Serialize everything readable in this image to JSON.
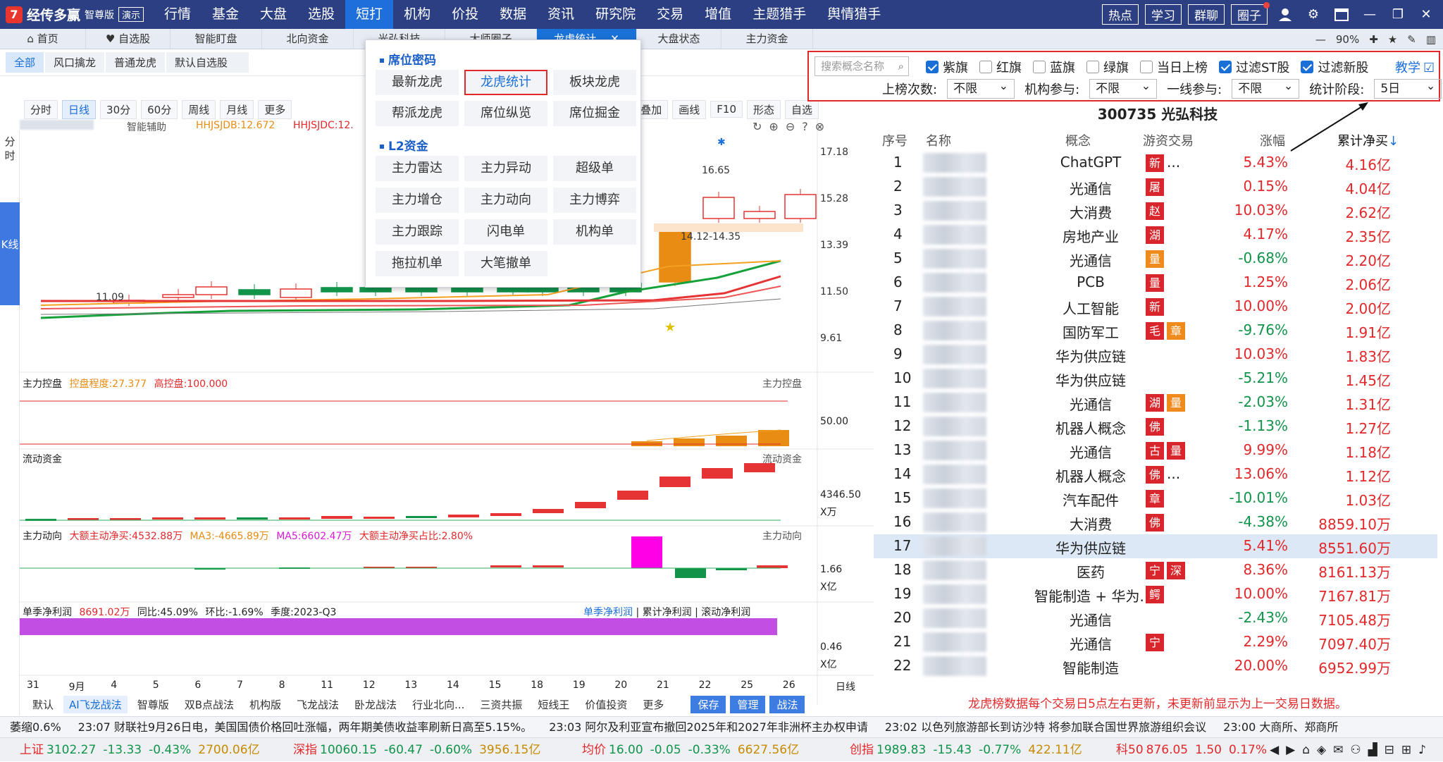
{
  "app": {
    "logo_mark": "7",
    "name": "经传多赢",
    "edition": "智尊版",
    "demo": "演示"
  },
  "main_menu": [
    "行情",
    "基金",
    "大盘",
    "选股",
    "短打",
    "机构",
    "价投",
    "数据",
    "资讯",
    "研究院",
    "交易",
    "增值",
    "主题猎手",
    "舆情猎手"
  ],
  "main_menu_active": 4,
  "top_right_buttons": [
    "热点",
    "学习",
    "群聊",
    "圈子"
  ],
  "tabs": [
    {
      "label": "首页",
      "icon": "home-icon"
    },
    {
      "label": "自选股",
      "icon": "heart-icon"
    },
    {
      "label": "智能盯盘"
    },
    {
      "label": "北向资金"
    },
    {
      "label": "光弘科技"
    },
    {
      "label": "大师圈子"
    },
    {
      "label": "龙虎统计",
      "active": true
    },
    {
      "label": "大盘状态"
    },
    {
      "label": "主力资金"
    }
  ],
  "zoom": "90%",
  "sub_tabs": [
    "全部",
    "风口擒龙",
    "普通龙虎",
    "默认自选股"
  ],
  "chart_toolbar": [
    "分时",
    "日线",
    "30分",
    "60分",
    "周线",
    "月线",
    "更多"
  ],
  "chart_toolbar_right": [
    "叠加",
    "画线",
    "F10",
    "形态",
    "自选"
  ],
  "left_strip": [
    "分时",
    "K线"
  ],
  "main_panel": {
    "assist_label": "智能辅助",
    "hhjsjdb": "HHJSJDB:12.672",
    "hhjsjdc": "HHJSJDC:12.",
    "price_labels": [
      "17.18",
      "15.28",
      "13.39",
      "11.50",
      "9.61"
    ],
    "hi_label": "16.65",
    "range_label": "14.12-14.35",
    "low_label": "11.09"
  },
  "panel2": {
    "name": "主力控盘",
    "degree": "控盘程度:27.377",
    "high": "高控盘:100.000",
    "right": "主力控盘",
    "axis": "50.00"
  },
  "panel3": {
    "name": "流动资金",
    "right": "流动资金",
    "axis": "4346.50",
    "unit": "X万"
  },
  "panel4": {
    "name": "主力动向",
    "a": "大额主动净买:4532.88万",
    "b": "MA3:-4665.89万",
    "c": "MA5:6602.47万",
    "d": "大额主动净买占比:2.80%",
    "right": "主力动向",
    "axis": "1.66",
    "unit": "X亿"
  },
  "panel5": {
    "a": "单季净利润",
    "b": "8691.02万",
    "c": "同比:45.09%",
    "d": "环比:-1.69%",
    "e": "季度:2023-Q3",
    "links": [
      "单季净利润",
      "累计净利润",
      "滚动净利润"
    ],
    "axis": "0.46",
    "unit": "X亿"
  },
  "x_axis": [
    "31",
    "9月",
    "4",
    "5",
    "6",
    "7",
    "8",
    "11",
    "12",
    "13",
    "14",
    "15",
    "18",
    "19",
    "20",
    "21",
    "22",
    "25",
    "26"
  ],
  "x_axis_right": "日线",
  "bottom_tabs": [
    "默认",
    "AI飞龙战法",
    "智尊版",
    "双B点战法",
    "机构版",
    "飞龙战法",
    "卧龙战法",
    "行业北向...",
    "三资共振",
    "短线王",
    "价值投资",
    "更多"
  ],
  "bottom_actions": [
    "保存",
    "管理",
    "战法"
  ],
  "dropdown": {
    "sec1": "席位密码",
    "items1": [
      "最新龙虎",
      "龙虎统计",
      "板块龙虎",
      "帮派龙虎",
      "席位纵览",
      "席位掘金"
    ],
    "sec2": "L2资金",
    "items2": [
      "主力雷达",
      "主力异动",
      "超级单",
      "主力增仓",
      "主力动向",
      "主力博弈",
      "主力跟踪",
      "闪电单",
      "机构单",
      "拖拉机单",
      "大笔撤单"
    ]
  },
  "filters": {
    "search_placeholder": "搜索概念名称",
    "flags": [
      {
        "label": "紫旗",
        "on": true
      },
      {
        "label": "红旗",
        "on": false
      },
      {
        "label": "蓝旗",
        "on": false
      },
      {
        "label": "绿旗",
        "on": false
      },
      {
        "label": "当日上榜",
        "on": false
      },
      {
        "label": "过滤ST股",
        "on": true
      },
      {
        "label": "过滤新股",
        "on": true
      }
    ],
    "teach": "教学",
    "row2": [
      {
        "label": "上榜次数:",
        "value": "不限"
      },
      {
        "label": "机构参与:",
        "value": "不限"
      },
      {
        "label": "一线参与:",
        "value": "不限"
      },
      {
        "label": "统计阶段:",
        "value": "5日"
      }
    ]
  },
  "stock_title": "300735  光弘科技",
  "table_headers": [
    "序号",
    "名称",
    "概念",
    "游资交易",
    "涨幅",
    "累计净买"
  ],
  "rows": [
    {
      "n": "1",
      "concept": "ChatGPT",
      "tags": [
        {
          "t": "新",
          "c": "r"
        }
      ],
      "extra": "...",
      "chg": "5.43%",
      "net": "4.16亿"
    },
    {
      "n": "2",
      "concept": "光通信",
      "tags": [
        {
          "t": "屠",
          "c": "r"
        }
      ],
      "chg": "0.15%",
      "net": "4.04亿"
    },
    {
      "n": "3",
      "concept": "大消费",
      "tags": [
        {
          "t": "赵",
          "c": "r"
        }
      ],
      "chg": "10.03%",
      "net": "2.62亿"
    },
    {
      "n": "4",
      "concept": "房地产业",
      "tags": [
        {
          "t": "湖",
          "c": "r"
        }
      ],
      "chg": "4.17%",
      "net": "2.35亿"
    },
    {
      "n": "5",
      "concept": "光通信",
      "tags": [
        {
          "t": "量",
          "c": "o"
        }
      ],
      "chg": "-0.68%",
      "net": "2.20亿"
    },
    {
      "n": "6",
      "concept": "PCB",
      "tags": [
        {
          "t": "量",
          "c": "r"
        }
      ],
      "chg": "1.25%",
      "net": "2.06亿"
    },
    {
      "n": "7",
      "concept": "人工智能",
      "tags": [
        {
          "t": "新",
          "c": "r"
        }
      ],
      "chg": "10.00%",
      "net": "2.00亿"
    },
    {
      "n": "8",
      "concept": "国防军工",
      "tags": [
        {
          "t": "毛",
          "c": "r"
        },
        {
          "t": "章",
          "c": "o"
        }
      ],
      "chg": "-9.76%",
      "net": "1.91亿"
    },
    {
      "n": "9",
      "concept": "华为供应链",
      "tags": [],
      "chg": "10.03%",
      "net": "1.83亿"
    },
    {
      "n": "10",
      "concept": "华为供应链",
      "tags": [],
      "chg": "-5.21%",
      "net": "1.45亿"
    },
    {
      "n": "11",
      "concept": "光通信",
      "tags": [
        {
          "t": "湖",
          "c": "r"
        },
        {
          "t": "量",
          "c": "o"
        }
      ],
      "chg": "-2.03%",
      "net": "1.31亿"
    },
    {
      "n": "12",
      "concept": "机器人概念",
      "tags": [
        {
          "t": "佛",
          "c": "r"
        }
      ],
      "chg": "-1.13%",
      "net": "1.27亿"
    },
    {
      "n": "13",
      "concept": "光通信",
      "tags": [
        {
          "t": "古",
          "c": "r"
        },
        {
          "t": "量",
          "c": "r"
        }
      ],
      "chg": "9.99%",
      "net": "1.18亿"
    },
    {
      "n": "14",
      "concept": "机器人概念",
      "tags": [
        {
          "t": "佛",
          "c": "r"
        }
      ],
      "extra": "...",
      "chg": "13.06%",
      "net": "1.12亿"
    },
    {
      "n": "15",
      "concept": "汽车配件",
      "tags": [
        {
          "t": "章",
          "c": "r"
        }
      ],
      "chg": "-10.01%",
      "net": "1.03亿"
    },
    {
      "n": "16",
      "concept": "大消费",
      "tags": [
        {
          "t": "佛",
          "c": "r"
        }
      ],
      "chg": "-4.38%",
      "net": "8859.10万"
    },
    {
      "n": "17",
      "concept": "华为供应链",
      "tags": [],
      "chg": "5.41%",
      "net": "8551.60万",
      "selected": true
    },
    {
      "n": "18",
      "concept": "医药",
      "tags": [
        {
          "t": "宁",
          "c": "r"
        },
        {
          "t": "深",
          "c": "r"
        }
      ],
      "chg": "8.36%",
      "net": "8161.13万"
    },
    {
      "n": "19",
      "concept": "智能制造 + 华为...",
      "tags": [
        {
          "t": "鳄",
          "c": "r"
        }
      ],
      "chg": "10.00%",
      "net": "7167.81万"
    },
    {
      "n": "20",
      "concept": "光通信",
      "tags": [],
      "chg": "-2.43%",
      "net": "7105.48万"
    },
    {
      "n": "21",
      "concept": "光通信",
      "tags": [
        {
          "t": "宁",
          "c": "r"
        }
      ],
      "chg": "2.29%",
      "net": "7097.40万"
    },
    {
      "n": "22",
      "concept": "智能制造",
      "tags": [],
      "chg": "20.00%",
      "net": "6952.99万"
    }
  ],
  "note": "龙虎榜数据每个交易日5点左右更新，未更新前显示为上一交易日数据。",
  "ticker": [
    "萎缩0.6%",
    "23:07 财联社9月26日电，美国国债价格回吐涨幅，两年期美债收益率刷新日高至5.15%。",
    "23:03 阿尔及利亚宣布撤回2025年和2027年非洲杯主办权申请",
    "23:02 以色列旅游部长到访沙特 将参加联合国世界旅游组织会议",
    "23:00 大商所、郑商所"
  ],
  "indices": [
    {
      "name": "上证",
      "v": "3102.27",
      "d": "-13.33",
      "p": "-0.43%",
      "a": "2700.06亿"
    },
    {
      "name": "深指",
      "v": "10060.15",
      "d": "-60.47",
      "p": "-0.60%",
      "a": "3956.15亿"
    },
    {
      "name": "均价",
      "v": "16.00",
      "d": "-0.05",
      "p": "-0.33%",
      "a": "6627.56亿"
    },
    {
      "name": "创指",
      "v": "1989.83",
      "d": "-15.43",
      "p": "-0.77%",
      "a": "422.11亿"
    },
    {
      "name": "科50",
      "v": "876.05",
      "d": "1.50",
      "p": "0.17%",
      "a": ""
    }
  ]
}
